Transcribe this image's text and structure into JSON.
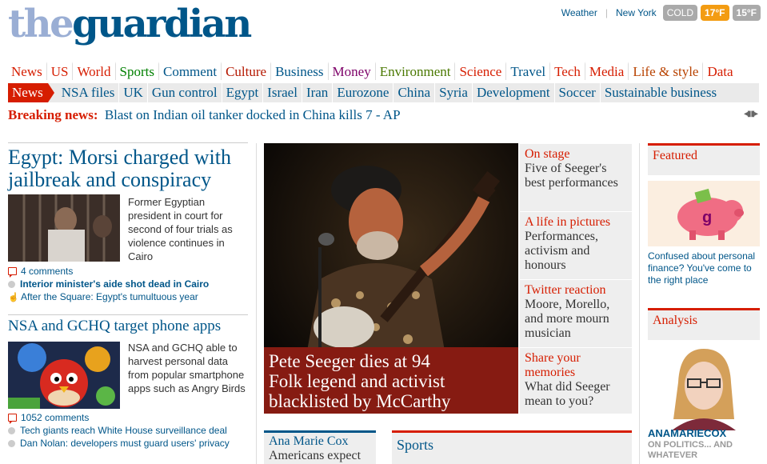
{
  "logo": {
    "the": "the",
    "guardian": "guardian"
  },
  "weather": {
    "label": "Weather",
    "city": "New York",
    "cold": "COLD",
    "now": "17°F",
    "low": "15°F",
    "colors": {
      "now": "#f39c12",
      "neutral": "#aaaaaa"
    }
  },
  "nav_primary": [
    {
      "label": "News",
      "color": "#d61d00"
    },
    {
      "label": "US",
      "color": "#d61d00"
    },
    {
      "label": "World",
      "color": "#d61d00"
    },
    {
      "label": "Sports",
      "color": "#008000"
    },
    {
      "label": "Comment",
      "color": "#005689"
    },
    {
      "label": "Culture",
      "color": "#b51800"
    },
    {
      "label": "Business",
      "color": "#005689"
    },
    {
      "label": "Money",
      "color": "#7d0068"
    },
    {
      "label": "Environment",
      "color": "#4a7801"
    },
    {
      "label": "Science",
      "color": "#d61d00"
    },
    {
      "label": "Travel",
      "color": "#005689"
    },
    {
      "label": "Tech",
      "color": "#d61d00"
    },
    {
      "label": "Media",
      "color": "#d61d00"
    },
    {
      "label": "Life & style",
      "color": "#b84200"
    },
    {
      "label": "Data",
      "color": "#d61d00"
    }
  ],
  "nav_secondary": {
    "tag": "News",
    "items": [
      "NSA files",
      "UK",
      "Gun control",
      "Egypt",
      "Israel",
      "Iran",
      "Eurozone",
      "China",
      "Syria",
      "Development",
      "Soccer",
      "Sustainable business"
    ]
  },
  "breaking": {
    "label": "Breaking news:",
    "text": "Blast on Indian oil tanker docked in China kills 7 - AP",
    "controls": "◂▮▮▸"
  },
  "story1": {
    "headline": "Egypt: Morsi charged with jailbreak and conspiracy",
    "standfirst": "Former Egyptian president in court for second of four trials as violence continues in Cairo",
    "comments": "4 comments",
    "related": [
      "Interior minister's aide shot dead in Cairo",
      "After the Square: Egypt's tumultuous year"
    ]
  },
  "story2": {
    "headline": "NSA and GCHQ target phone apps",
    "standfirst": "NSA and GCHQ able to harvest personal data from popular smartphone apps such as Angry Birds",
    "comments": "1052 comments",
    "related": [
      "Tech giants reach White House surveillance deal",
      "Dan Nolan: developers must guard users' privacy"
    ]
  },
  "feature": {
    "caption": [
      "Pete Seeger dies at 94",
      "Folk legend and activist",
      "blacklisted by McCarthy"
    ]
  },
  "side_links": [
    {
      "kicker": "On stage",
      "text": "Five of Seeger's best performances"
    },
    {
      "kicker": "A life in pictures",
      "text": "Performances, activism and honours"
    },
    {
      "kicker": "Twitter reaction",
      "text": "Moore, Morello, and more mourn musician"
    },
    {
      "kicker": "Share your memories",
      "text": "What did Seeger mean to you?"
    }
  ],
  "featured": {
    "title": "Featured",
    "text": "Confused about personal finance? You've come to the right place",
    "piggy_letter": "g"
  },
  "analysis": {
    "title": "Analysis",
    "name": "ANAMARIECOX",
    "tagline": "ON POLITICS... AND WHATEVER"
  },
  "bottom_left": {
    "kicker": "Ana Marie Cox",
    "text": "Americans expect"
  },
  "bottom_mid": {
    "title": "Sports"
  }
}
